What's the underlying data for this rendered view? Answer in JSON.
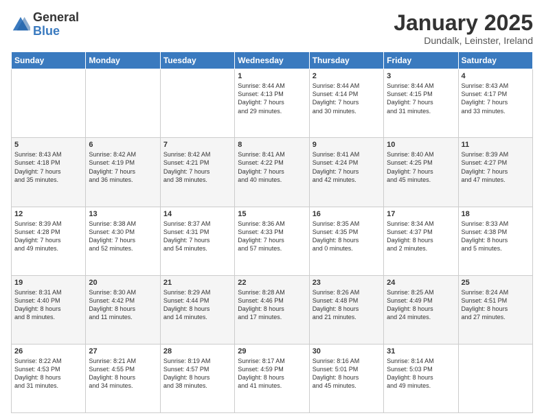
{
  "logo": {
    "general": "General",
    "blue": "Blue"
  },
  "title": "January 2025",
  "subtitle": "Dundalk, Leinster, Ireland",
  "weekdays": [
    "Sunday",
    "Monday",
    "Tuesday",
    "Wednesday",
    "Thursday",
    "Friday",
    "Saturday"
  ],
  "weeks": [
    [
      {
        "day": "",
        "info": ""
      },
      {
        "day": "",
        "info": ""
      },
      {
        "day": "",
        "info": ""
      },
      {
        "day": "1",
        "info": "Sunrise: 8:44 AM\nSunset: 4:13 PM\nDaylight: 7 hours\nand 29 minutes."
      },
      {
        "day": "2",
        "info": "Sunrise: 8:44 AM\nSunset: 4:14 PM\nDaylight: 7 hours\nand 30 minutes."
      },
      {
        "day": "3",
        "info": "Sunrise: 8:44 AM\nSunset: 4:15 PM\nDaylight: 7 hours\nand 31 minutes."
      },
      {
        "day": "4",
        "info": "Sunrise: 8:43 AM\nSunset: 4:17 PM\nDaylight: 7 hours\nand 33 minutes."
      }
    ],
    [
      {
        "day": "5",
        "info": "Sunrise: 8:43 AM\nSunset: 4:18 PM\nDaylight: 7 hours\nand 35 minutes."
      },
      {
        "day": "6",
        "info": "Sunrise: 8:42 AM\nSunset: 4:19 PM\nDaylight: 7 hours\nand 36 minutes."
      },
      {
        "day": "7",
        "info": "Sunrise: 8:42 AM\nSunset: 4:21 PM\nDaylight: 7 hours\nand 38 minutes."
      },
      {
        "day": "8",
        "info": "Sunrise: 8:41 AM\nSunset: 4:22 PM\nDaylight: 7 hours\nand 40 minutes."
      },
      {
        "day": "9",
        "info": "Sunrise: 8:41 AM\nSunset: 4:24 PM\nDaylight: 7 hours\nand 42 minutes."
      },
      {
        "day": "10",
        "info": "Sunrise: 8:40 AM\nSunset: 4:25 PM\nDaylight: 7 hours\nand 45 minutes."
      },
      {
        "day": "11",
        "info": "Sunrise: 8:39 AM\nSunset: 4:27 PM\nDaylight: 7 hours\nand 47 minutes."
      }
    ],
    [
      {
        "day": "12",
        "info": "Sunrise: 8:39 AM\nSunset: 4:28 PM\nDaylight: 7 hours\nand 49 minutes."
      },
      {
        "day": "13",
        "info": "Sunrise: 8:38 AM\nSunset: 4:30 PM\nDaylight: 7 hours\nand 52 minutes."
      },
      {
        "day": "14",
        "info": "Sunrise: 8:37 AM\nSunset: 4:31 PM\nDaylight: 7 hours\nand 54 minutes."
      },
      {
        "day": "15",
        "info": "Sunrise: 8:36 AM\nSunset: 4:33 PM\nDaylight: 7 hours\nand 57 minutes."
      },
      {
        "day": "16",
        "info": "Sunrise: 8:35 AM\nSunset: 4:35 PM\nDaylight: 8 hours\nand 0 minutes."
      },
      {
        "day": "17",
        "info": "Sunrise: 8:34 AM\nSunset: 4:37 PM\nDaylight: 8 hours\nand 2 minutes."
      },
      {
        "day": "18",
        "info": "Sunrise: 8:33 AM\nSunset: 4:38 PM\nDaylight: 8 hours\nand 5 minutes."
      }
    ],
    [
      {
        "day": "19",
        "info": "Sunrise: 8:31 AM\nSunset: 4:40 PM\nDaylight: 8 hours\nand 8 minutes."
      },
      {
        "day": "20",
        "info": "Sunrise: 8:30 AM\nSunset: 4:42 PM\nDaylight: 8 hours\nand 11 minutes."
      },
      {
        "day": "21",
        "info": "Sunrise: 8:29 AM\nSunset: 4:44 PM\nDaylight: 8 hours\nand 14 minutes."
      },
      {
        "day": "22",
        "info": "Sunrise: 8:28 AM\nSunset: 4:46 PM\nDaylight: 8 hours\nand 17 minutes."
      },
      {
        "day": "23",
        "info": "Sunrise: 8:26 AM\nSunset: 4:48 PM\nDaylight: 8 hours\nand 21 minutes."
      },
      {
        "day": "24",
        "info": "Sunrise: 8:25 AM\nSunset: 4:49 PM\nDaylight: 8 hours\nand 24 minutes."
      },
      {
        "day": "25",
        "info": "Sunrise: 8:24 AM\nSunset: 4:51 PM\nDaylight: 8 hours\nand 27 minutes."
      }
    ],
    [
      {
        "day": "26",
        "info": "Sunrise: 8:22 AM\nSunset: 4:53 PM\nDaylight: 8 hours\nand 31 minutes."
      },
      {
        "day": "27",
        "info": "Sunrise: 8:21 AM\nSunset: 4:55 PM\nDaylight: 8 hours\nand 34 minutes."
      },
      {
        "day": "28",
        "info": "Sunrise: 8:19 AM\nSunset: 4:57 PM\nDaylight: 8 hours\nand 38 minutes."
      },
      {
        "day": "29",
        "info": "Sunrise: 8:17 AM\nSunset: 4:59 PM\nDaylight: 8 hours\nand 41 minutes."
      },
      {
        "day": "30",
        "info": "Sunrise: 8:16 AM\nSunset: 5:01 PM\nDaylight: 8 hours\nand 45 minutes."
      },
      {
        "day": "31",
        "info": "Sunrise: 8:14 AM\nSunset: 5:03 PM\nDaylight: 8 hours\nand 49 minutes."
      },
      {
        "day": "",
        "info": ""
      }
    ]
  ]
}
